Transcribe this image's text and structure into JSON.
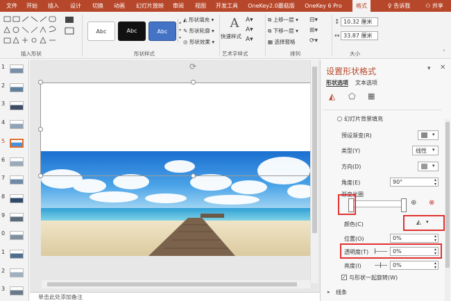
{
  "tabs": [
    {
      "label": "文件"
    },
    {
      "label": "开始"
    },
    {
      "label": "插入"
    },
    {
      "label": "设计"
    },
    {
      "label": "切换"
    },
    {
      "label": "动画"
    },
    {
      "label": "幻灯片放映"
    },
    {
      "label": "审阅"
    },
    {
      "label": "视图"
    },
    {
      "label": "开发工具"
    },
    {
      "label": "OneKey2.0蘑菇版"
    },
    {
      "label": "OneKey 6 Pro"
    },
    {
      "label": "格式"
    }
  ],
  "tell_me": "告诉我",
  "share": "共享",
  "ribbon": {
    "insert_shapes_label": "插入形状",
    "shape_styles_label": "形状样式",
    "style_sample": "Abc",
    "shape_fill": "形状填充",
    "shape_outline": "形状轮廓",
    "shape_effects": "形状效果",
    "quick_styles": "快速样式",
    "wordart_label": "艺术字样式",
    "bring_forward": "上移一层",
    "send_backward": "下移一层",
    "selection_pane": "选择窗格",
    "arrange_label": "排列",
    "height_value": "10.32 厘米",
    "width_value": "33.87 厘米",
    "size_label": "大小"
  },
  "slides": [
    {
      "num": "1"
    },
    {
      "num": "2"
    },
    {
      "num": "3"
    },
    {
      "num": "4"
    },
    {
      "num": "5"
    },
    {
      "num": "6"
    },
    {
      "num": "7"
    },
    {
      "num": "8"
    },
    {
      "num": "9"
    },
    {
      "num": "0"
    },
    {
      "num": "1"
    },
    {
      "num": "2"
    },
    {
      "num": "3"
    }
  ],
  "notes_placeholder": "单击此处添加备注",
  "pane": {
    "title": "设置形状格式",
    "tab_shape_options": "形状选项",
    "tab_text_options": "文本选项",
    "slide_bg_fill": "幻灯片背景填充",
    "preset_gradient": "预设渐变(R)",
    "type_label": "类型(Y)",
    "type_value": "线性",
    "direction_label": "方向(D)",
    "angle_label": "角度(E)",
    "angle_value": "90°",
    "gradient_stops_label": "渐变光圈",
    "color_label": "颜色(C)",
    "position_label": "位置(O)",
    "position_value": "0%",
    "transparency_label": "透明度(T)",
    "transparency_value": "0%",
    "brightness_label": "亮度(I)",
    "brightness_value": "0%",
    "rotate_with_shape": "与形状一起旋转(W)",
    "line_section": "线条"
  }
}
